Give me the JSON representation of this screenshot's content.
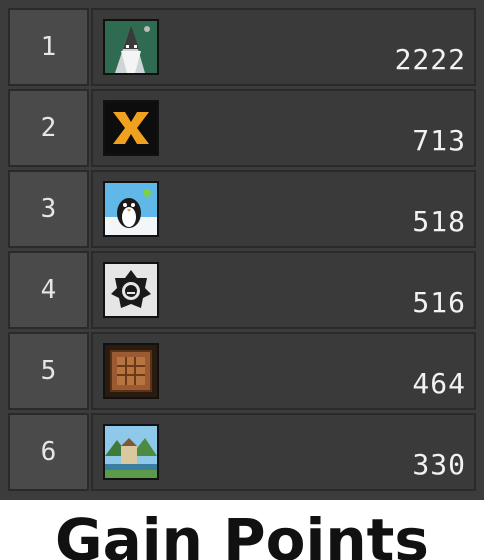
{
  "leaderboard": [
    {
      "rank": "1",
      "score": "2222",
      "icon": "wizard-avatar-icon"
    },
    {
      "rank": "2",
      "score": "713",
      "icon": "orange-m-logo-avatar-icon"
    },
    {
      "rank": "3",
      "score": "518",
      "icon": "penguin-avatar-icon"
    },
    {
      "rank": "4",
      "score": "516",
      "icon": "black-emblem-avatar-icon"
    },
    {
      "rank": "5",
      "score": "464",
      "icon": "crafting-table-avatar-icon"
    },
    {
      "rank": "6",
      "score": "330",
      "icon": "castle-landscape-avatar-icon"
    }
  ],
  "caption": "Gain Points"
}
